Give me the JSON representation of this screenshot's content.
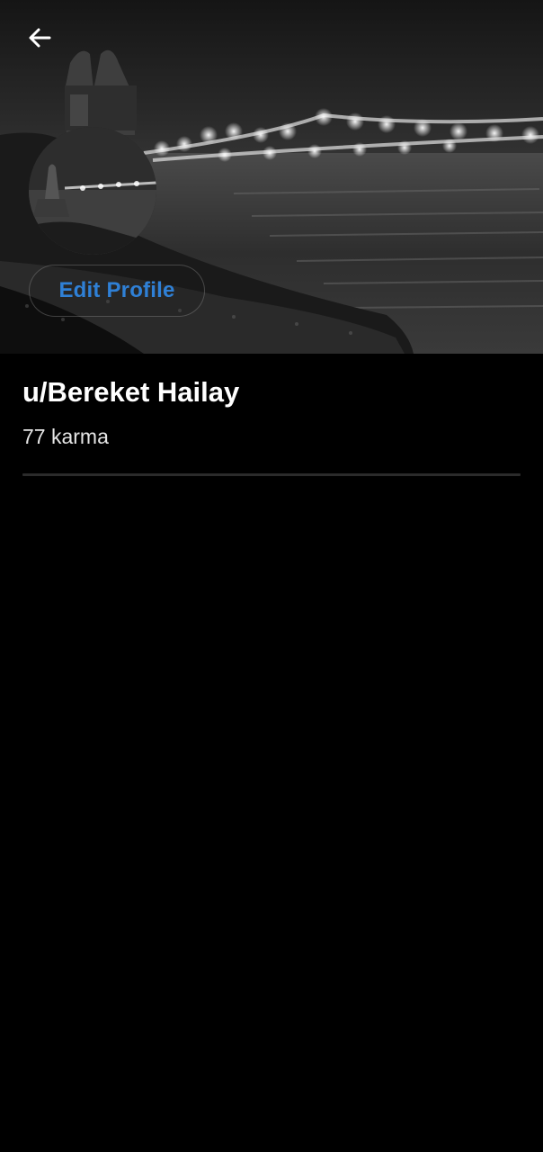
{
  "header": {
    "back_icon": "arrow-left-icon"
  },
  "banner": {
    "description_icon": "cover-photo"
  },
  "profile": {
    "edit_label": "Edit Profile",
    "username": "u/Bereket Hailay",
    "karma": "77 karma"
  },
  "colors": {
    "background": "#000000",
    "accent": "#2f80d6",
    "text_primary": "#ffffff",
    "divider": "#2b2b2b"
  }
}
